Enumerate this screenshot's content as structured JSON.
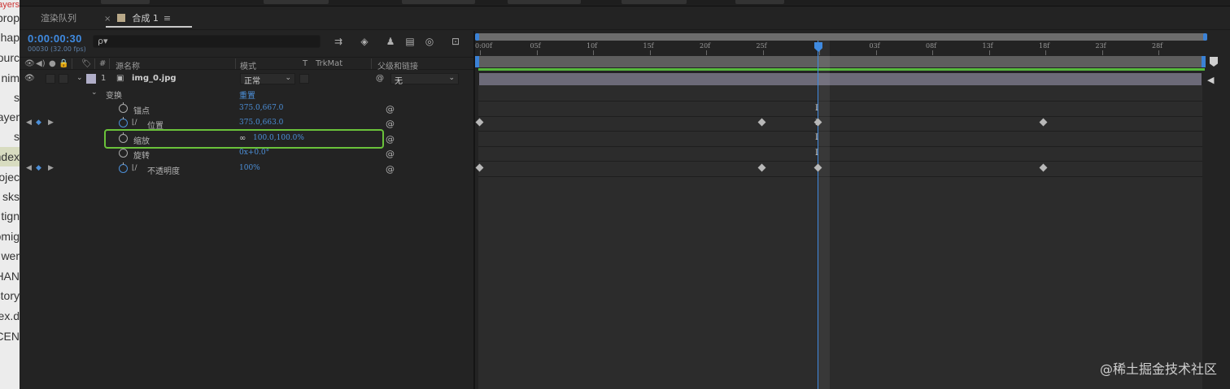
{
  "background_app": {
    "lines": [
      "Layers",
      "prop",
      "hap",
      "ourc",
      "nim",
      "s",
      "ayer",
      "s",
      "ndex",
      "ojec",
      "sks",
      "tign",
      "omig",
      "wer",
      "HAN",
      "story",
      "dex.d",
      "CEN"
    ]
  },
  "tabs": {
    "render_queue": "渲染队列",
    "comp_close": "×",
    "comp_name": "合成 1",
    "comp_menu": "≡"
  },
  "timeline_panel": {
    "timecode": "0:00:00:30",
    "fps_info": "00030 (32.00 fps)",
    "search_icon": "ρ▾",
    "columns": {
      "hash": "#",
      "source_name": "源名称",
      "mode": "模式",
      "t": "T",
      "trkmat": "TrkMat",
      "parent": "父级和链接"
    },
    "layer": {
      "number": "1",
      "name": "img_0.jpg",
      "mode": "正常",
      "parent": "无"
    },
    "transform": {
      "label": "变换",
      "reset": "重置"
    },
    "properties": [
      {
        "name": "锚点",
        "value": "375.0,667.0"
      },
      {
        "name": "位置",
        "value": "375.0,663.0"
      },
      {
        "name": "缩放",
        "value": "100.0,100.0%"
      },
      {
        "name": "旋转",
        "value": "0x+0.0°"
      },
      {
        "name": "不透明度",
        "value": "100%"
      }
    ]
  },
  "ruler": {
    "ticks": [
      "0:00f",
      "05f",
      "10f",
      "15f",
      "20f",
      "25f",
      "",
      "03f",
      "08f",
      "13f",
      "18f",
      "23f",
      "28f"
    ]
  },
  "keyframes": {
    "position_frames": [
      "0:00f",
      "25f",
      "30f",
      "18f"
    ],
    "opacity_frames": [
      "0:00f",
      "25f",
      "30f",
      "18f"
    ]
  },
  "watermark": "@稀土掘金技术社区",
  "colors": {
    "accent_blue": "#3f8ae0",
    "highlight_green": "#6ac23a",
    "layer_bar": "#6c6a78"
  }
}
